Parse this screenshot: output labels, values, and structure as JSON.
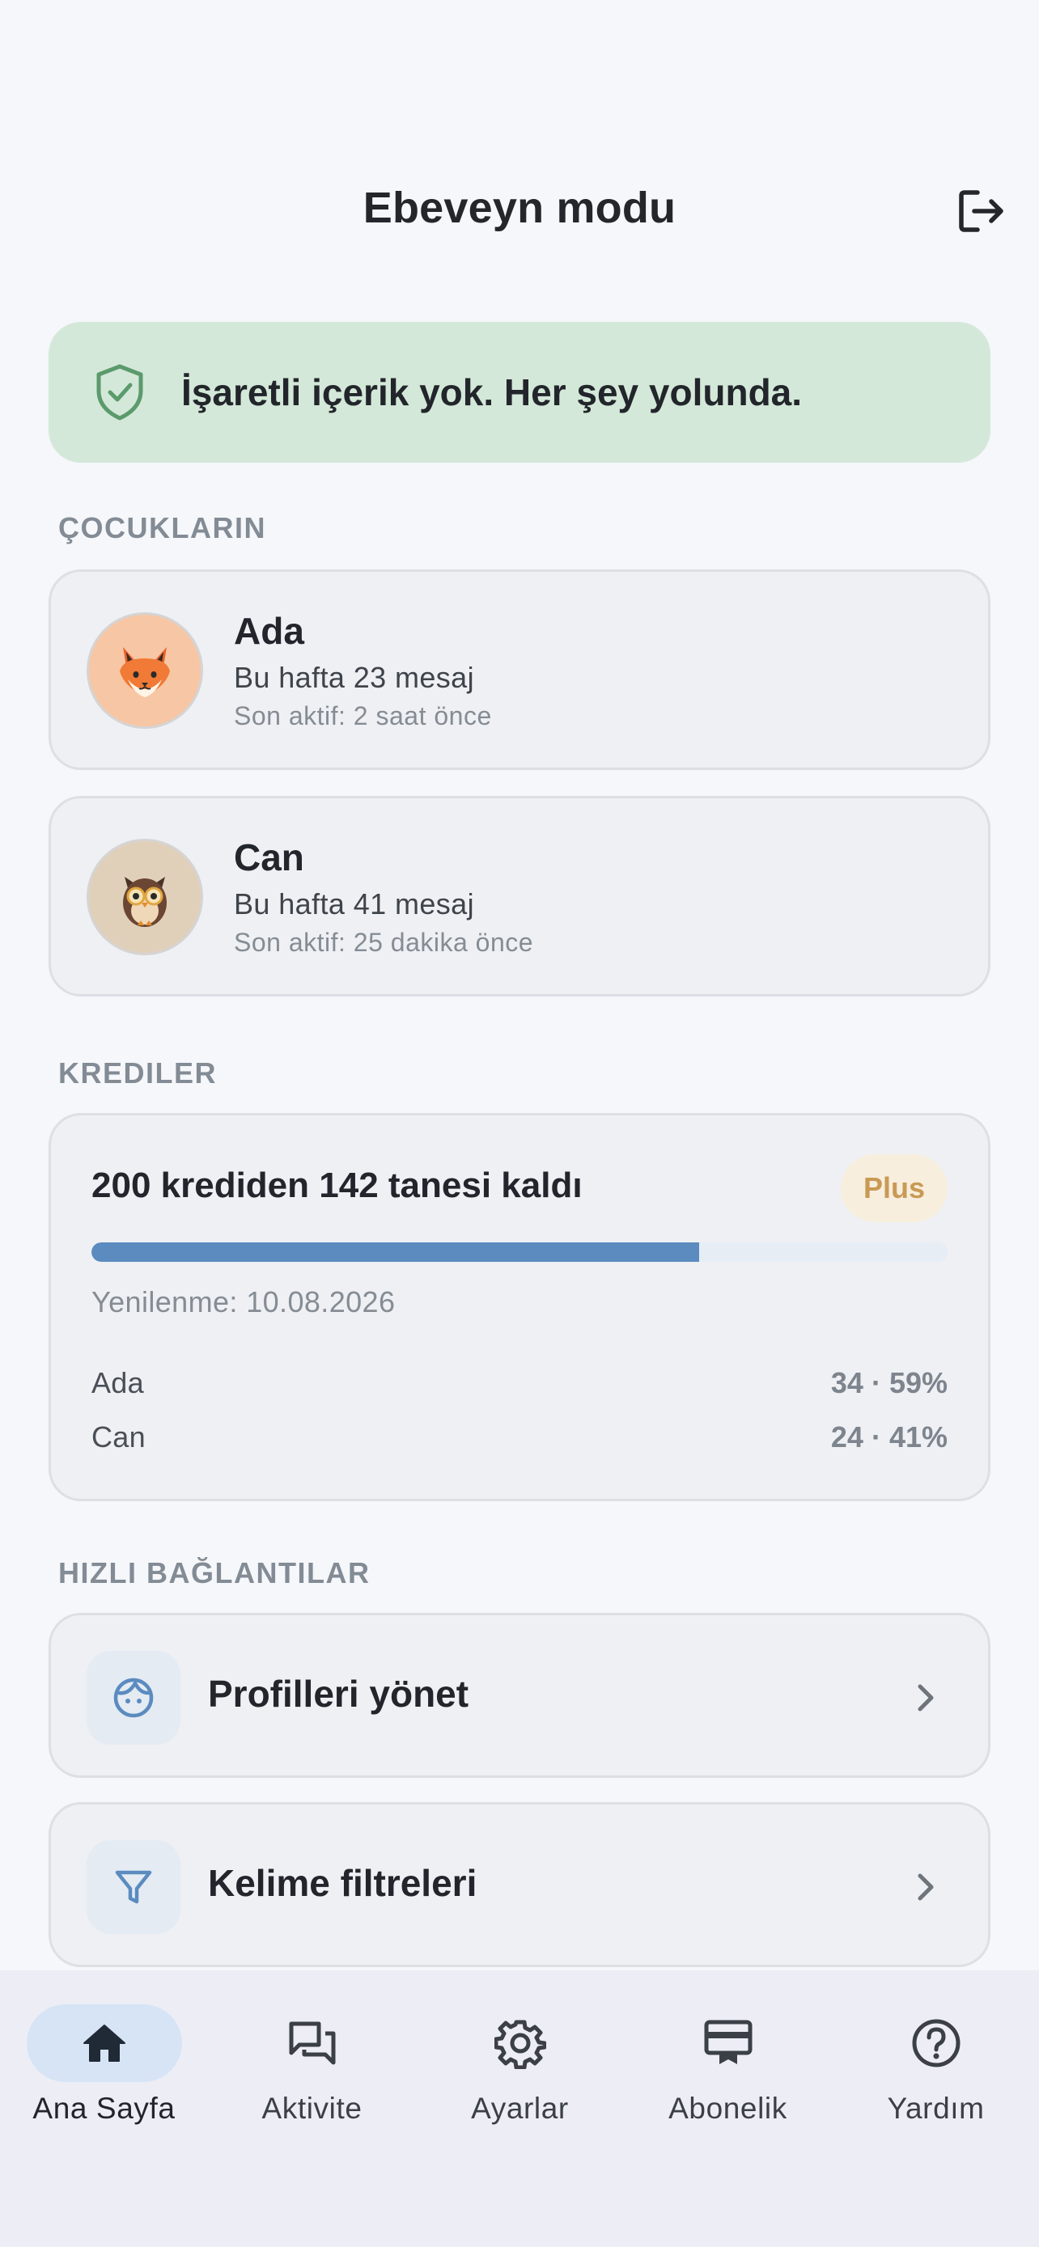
{
  "header": {
    "title": "Ebeveyn modu",
    "logout_icon": "logout-icon"
  },
  "alert": {
    "icon": "shield-check-icon",
    "text": "İşaretli içerik yok. Her şey yolunda.",
    "bg_color": "#d4e8d9"
  },
  "children_section": {
    "label": "ÇOCUKLARIN",
    "children": [
      {
        "name": "Ada",
        "avatar": "fox-avatar",
        "messages": "Bu hafta 23 mesaj",
        "last_active": "Son aktif: 2 saat önce"
      },
      {
        "name": "Can",
        "avatar": "owl-avatar",
        "messages": "Bu hafta 41 mesaj",
        "last_active": "Son aktif: 25 dakika önce"
      }
    ]
  },
  "credits_section": {
    "label": "KREDILER",
    "title": "200 krediden 142 tanesi kaldı",
    "plan": "Plus",
    "remaining_fraction": 0.71,
    "renewal": "Yenilenme: 10.08.2026",
    "usage": [
      {
        "name": "Ada",
        "value": "34 · 59%"
      },
      {
        "name": "Can",
        "value": "24 · 41%"
      }
    ],
    "accent_color": "#5b8bbf"
  },
  "quick_links_section": {
    "label": "HIZLI BAĞLANTILAR",
    "links": [
      {
        "label": "Profilleri yönet",
        "icon": "face-icon"
      },
      {
        "label": "Kelime filtreleri",
        "icon": "filter-icon"
      }
    ]
  },
  "bottom_nav": {
    "items": [
      {
        "label": "Ana Sayfa",
        "icon": "home-icon",
        "active": true
      },
      {
        "label": "Aktivite",
        "icon": "chat-icon",
        "active": false
      },
      {
        "label": "Ayarlar",
        "icon": "gear-icon",
        "active": false
      },
      {
        "label": "Abonelik",
        "icon": "card-icon",
        "active": false
      },
      {
        "label": "Yardım",
        "icon": "help-icon",
        "active": false
      }
    ]
  }
}
